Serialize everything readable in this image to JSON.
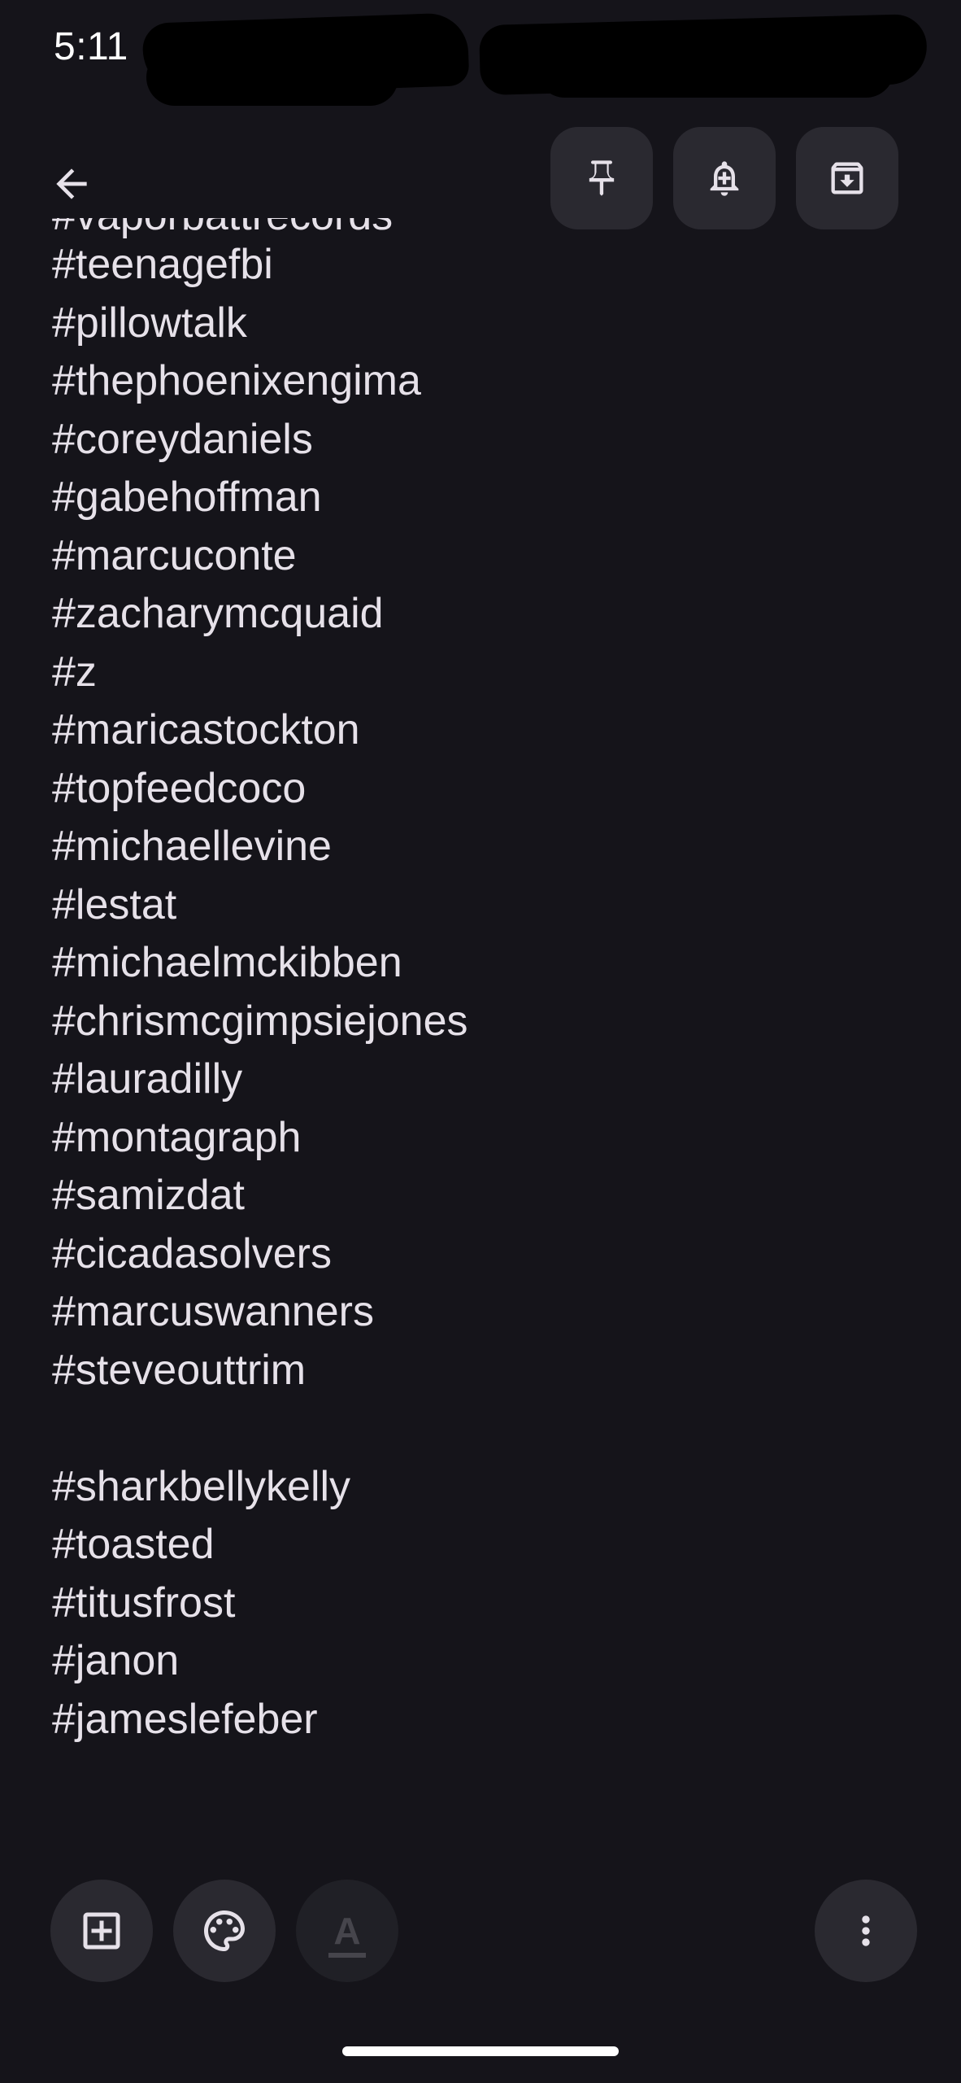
{
  "status_bar": {
    "time": "5:11"
  },
  "top_bar": {
    "icons": [
      "back-arrow-icon",
      "pin-icon",
      "reminder-bell-icon",
      "archive-icon"
    ]
  },
  "note": {
    "partial_top_line": "#vaporbattrecords",
    "lines": [
      "#teenagefbi",
      "#pillowtalk",
      "#thephoenixengima",
      "#coreydaniels",
      "#gabehoffman",
      "#marcuconte",
      "#zacharymcquaid",
      "#z",
      "#maricastockton",
      "#topfeedcoco",
      "#michaellevine",
      "#lestat",
      "#michaelmckibben",
      "#chrismcgimpsiejones",
      "#lauradilly",
      "#montagraph",
      "#samizdat",
      "#cicadasolvers",
      "#marcuswanners",
      "#steveouttrim",
      "",
      "#sharkbellykelly",
      "#toasted",
      "#titusfrost",
      "#janon",
      "#jameslefeber"
    ]
  },
  "bottom_toolbar": {
    "format_letter": "A",
    "icons": [
      "add-box-icon",
      "palette-icon",
      "text-format-icon",
      "more-vert-icon"
    ]
  },
  "colors": {
    "background": "#15141a",
    "button_background": "#2a2930",
    "text": "#e6e1e9",
    "disabled": "#46454c"
  }
}
